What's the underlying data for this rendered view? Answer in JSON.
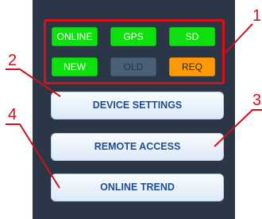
{
  "status_indicators": [
    {
      "label": "ONLINE",
      "state": "green"
    },
    {
      "label": "GPS",
      "state": "green"
    },
    {
      "label": "SD",
      "state": "green"
    },
    {
      "label": "NEW",
      "state": "green"
    },
    {
      "label": "OLD",
      "state": "gray"
    },
    {
      "label": "REQ",
      "state": "orange"
    }
  ],
  "buttons": {
    "device_settings": "DEVICE SETTINGS",
    "remote_access": "REMOTE ACCESS",
    "online_trend": "ONLINE TREND"
  },
  "callouts": {
    "c1": "1",
    "c2": "2",
    "c3": "3",
    "c4": "4"
  },
  "colors": {
    "panel_bg": "#2b3647",
    "indicator_green": "#0ee00e",
    "indicator_gray": "#4a5f78",
    "indicator_orange": "#ff9a05",
    "callout_red": "#d0101a",
    "button_text": "#1f4e94"
  }
}
